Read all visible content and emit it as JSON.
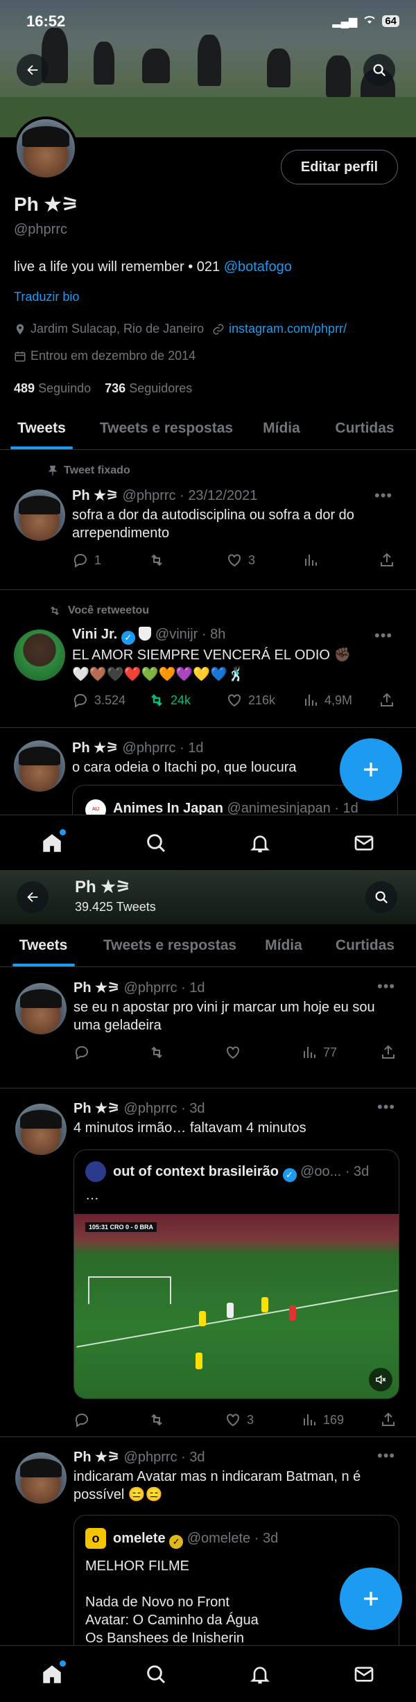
{
  "status": {
    "time": "16:52",
    "battery": "64"
  },
  "profile": {
    "name": "Ph ★⚞",
    "handle": "@phprrc",
    "edit_label": "Editar perfil",
    "bio_text": "live a life you will remember • 021 ",
    "bio_link": "@botafogo",
    "translate_label": "Traduzir bio",
    "location": "Jardim Sulacap, Rio de Janeiro",
    "website": "instagram.com/phprr/",
    "joined": "Entrou em dezembro de 2014",
    "following_count": "489",
    "following_label": "Seguindo",
    "followers_count": "736",
    "followers_label": "Seguidores"
  },
  "tabs": [
    "Tweets",
    "Tweets e respostas",
    "Mídia",
    "Curtidas"
  ],
  "screen1": {
    "pinned": {
      "context": "Tweet fixado",
      "name": "Ph ★⚞",
      "meta": "@phprrc · 23/12/2021",
      "text": "sofra a dor da autodisciplina ou sofra a dor do arrependimento",
      "replies": "1",
      "retweets": "",
      "likes": "3",
      "views": ""
    },
    "retweet": {
      "context": "Você retweetou",
      "name": "Vini Jr.",
      "meta": "@vinijr · 8h",
      "text": "EL AMOR SIEMPRE VENCERÁ EL ODIO ✊🏿",
      "hearts": "🤍🤎🖤❤️💚🧡💜💛💙🕺🏿",
      "replies": "3.524",
      "retweets": "24k",
      "likes": "216k",
      "views": "4,9M"
    },
    "third": {
      "name": "Ph ★⚞",
      "meta": "@phprrc · 1d",
      "text": "o cara odeia o Itachi po, que loucura",
      "quote_name": "Animes In Japan",
      "quote_meta": "@animesinjapan · 1d"
    }
  },
  "screen2": {
    "header_name": "Ph ★⚞",
    "header_count": "39.425 Tweets",
    "tweet1": {
      "name": "Ph ★⚞",
      "meta": "@phprrc · 1d",
      "text": "se eu n apostar pro vini jr marcar um hoje eu sou uma geladeira",
      "views": "77"
    },
    "tweet2": {
      "name": "Ph ★⚞",
      "meta": "@phprrc · 3d",
      "text": "4 minutos irmão… faltavam 4 minutos",
      "quote_name": "out of context brasileirão",
      "quote_meta": "@oo... · 3d",
      "quote_text": "…",
      "scoreboard": "105:31 CRO 0 - 0 BRA",
      "likes": "3",
      "views": "169"
    },
    "tweet3": {
      "name": "Ph ★⚞",
      "meta": "@phprrc · 3d",
      "text": "indicaram Avatar mas n indicaram Batman, n é possível 😑😑",
      "quote_name": "omelete",
      "quote_meta": "@omelete · 3d",
      "quote_lines": [
        "MELHOR FILME",
        "",
        "Nada de Novo no Front",
        "Avatar: O Caminho da Água",
        "Os Banshees de Inisherin"
      ]
    }
  },
  "colors": {
    "accent": "#1d9bf0",
    "retweet_green": "#00ba7c",
    "muted": "#71767b"
  }
}
